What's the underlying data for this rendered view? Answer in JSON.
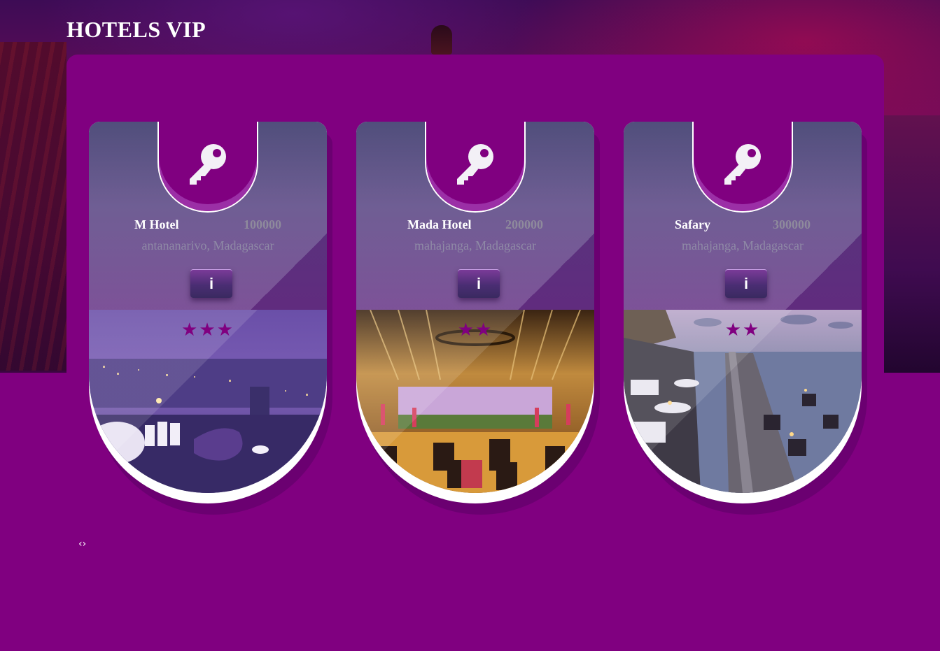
{
  "site": {
    "title": "HOTELS VIP"
  },
  "colors": {
    "background": "#800080",
    "accent": "#800080",
    "card_top": "#5f4c88"
  },
  "hotels": [
    {
      "name": "M Hotel",
      "price": "100000",
      "location": "antananarivo, Madagascar",
      "info_label": "i",
      "stars": "★★★",
      "photo": "city-night-terrace"
    },
    {
      "name": "Mada Hotel",
      "price": "200000",
      "location": "mahajanga, Madagascar",
      "info_label": "i",
      "stars": "★★",
      "photo": "lounge-interior"
    },
    {
      "name": "Safary",
      "price": "300000",
      "location": "mahajanga, Madagascar",
      "info_label": "i",
      "stars": "★★",
      "photo": "ocean-deck"
    }
  ],
  "pager": {
    "label": "‹›"
  },
  "icons": {
    "card_icon": "key-icon",
    "rating_icon": "star-icon"
  }
}
